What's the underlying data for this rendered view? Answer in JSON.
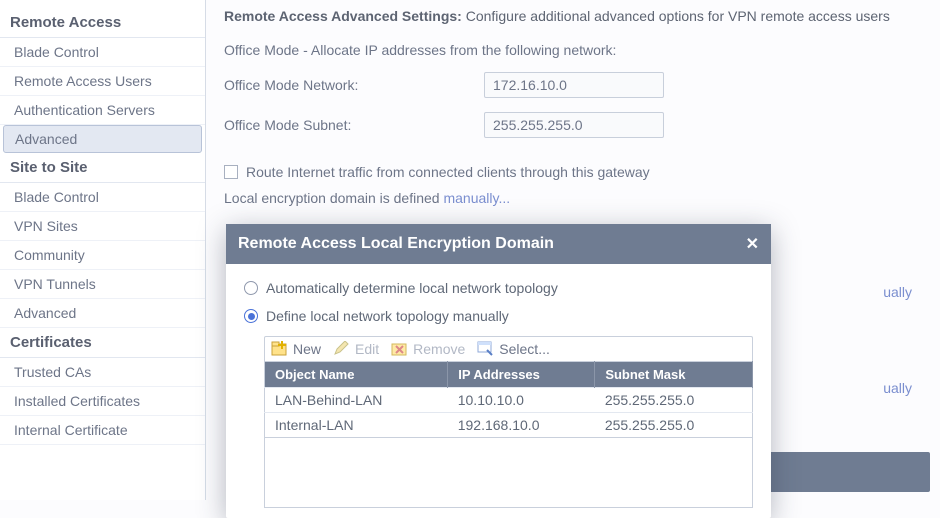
{
  "sidebar": {
    "groups": [
      {
        "heading": "Remote Access",
        "items": [
          "Blade Control",
          "Remote Access Users",
          "Authentication Servers",
          "Advanced"
        ],
        "selected": 3
      },
      {
        "heading": "Site to Site",
        "items": [
          "Blade Control",
          "VPN Sites",
          "Community",
          "VPN Tunnels",
          "Advanced"
        ]
      },
      {
        "heading": "Certificates",
        "items": [
          "Trusted CAs",
          "Installed Certificates",
          "Internal Certificate"
        ]
      }
    ]
  },
  "main": {
    "title_bold": "Remote Access Advanced Settings:",
    "title_rest": " Configure additional advanced options for VPN remote access users",
    "office_mode_heading": "Office Mode - Allocate IP addresses from the following network:",
    "network_label": "Office Mode Network:",
    "network_value": "172.16.10.0",
    "subnet_label": "Office Mode Subnet:",
    "subnet_value": "255.255.255.0",
    "route_checkbox": "Route Internet traffic from connected clients through this gateway",
    "enc_text": "Local encryption domain is defined ",
    "enc_link": "manually...",
    "ghost1": "ually",
    "ghost2": "ually"
  },
  "modal": {
    "title": "Remote Access Local Encryption Domain",
    "opt_auto": "Automatically determine local network topology",
    "opt_manual": "Define local network topology manually",
    "selected": "manual",
    "toolbar": {
      "new": "New",
      "edit": "Edit",
      "remove": "Remove",
      "select": "Select..."
    },
    "columns": [
      "Object Name",
      "IP Addresses",
      "Subnet Mask"
    ],
    "rows": [
      {
        "name": "LAN-Behind-LAN",
        "ip": "10.10.10.0",
        "mask": "255.255.255.0"
      },
      {
        "name": "Internal-LAN",
        "ip": "192.168.10.0",
        "mask": "255.255.255.0"
      }
    ]
  }
}
